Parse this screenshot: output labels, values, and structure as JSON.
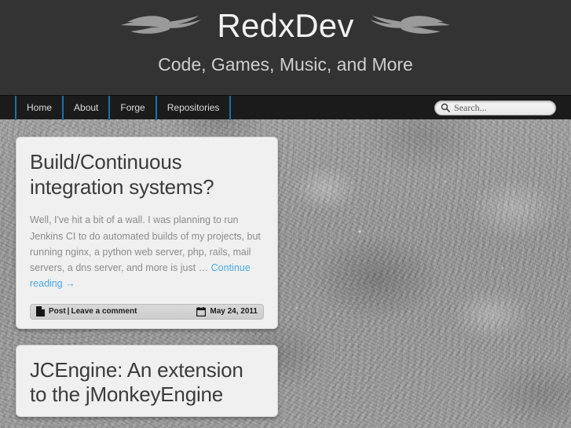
{
  "site": {
    "title": "RedxDev",
    "tagline": "Code, Games, Music, and More",
    "ornament_left": "flame-ornament-left",
    "ornament_right": "flame-ornament-right"
  },
  "nav": {
    "items": [
      {
        "label": "Home"
      },
      {
        "label": "About"
      },
      {
        "label": "Forge"
      },
      {
        "label": "Repositories"
      }
    ]
  },
  "search": {
    "icon": "search-icon",
    "placeholder": "Search...",
    "value": ""
  },
  "posts": [
    {
      "title": "Build/Continuous integration systems?",
      "excerpt": "Well, I've hit a bit of a wall. I was planning to run Jenkins CI to do automated builds of my projects, but running nginx, a python web server, php, rails, mail servers, a dns server, and more is just … ",
      "more_label": "Continue reading →",
      "meta": {
        "format_icon": "document-icon",
        "format_label": "Post",
        "separator": "|",
        "comments_label": "Leave a comment",
        "date_icon": "calendar-icon",
        "date": "May 24, 2011"
      }
    },
    {
      "title": "JCEngine: An extension to the jMonkeyEngine"
    }
  ],
  "colors": {
    "header_bg": "#333333",
    "nav_bg": "#1b1b1b",
    "nav_divider": "#1f6fa8",
    "link_blue": "#4aa9e8",
    "card_bg": "#f0f0f0",
    "page_bg": "#9c9c9c",
    "title_text": "#3b3b3b",
    "body_text": "#8c8c8c"
  }
}
